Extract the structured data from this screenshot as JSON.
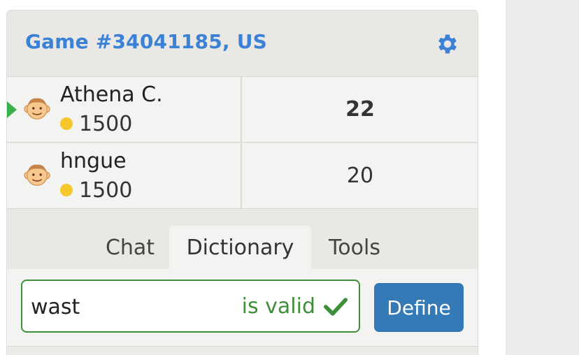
{
  "game": {
    "title": "Game #34041185, US"
  },
  "players": [
    {
      "name": "Athena C.",
      "rating": "1500",
      "score": "22",
      "active": true
    },
    {
      "name": "hngue",
      "rating": "1500",
      "score": "20",
      "active": false
    }
  ],
  "tabs": [
    {
      "label": "Chat"
    },
    {
      "label": "Dictionary",
      "selected": true
    },
    {
      "label": "Tools"
    }
  ],
  "dictionary": {
    "word": "wast",
    "status": "is valid",
    "define_label": "Define"
  },
  "icons": {
    "settings": "gear-icon",
    "avatar": "smiling-face-icon",
    "coin": "coin-icon",
    "valid": "check-icon"
  },
  "colors": {
    "accent": "#3b82d6",
    "valid": "#3f8f3a",
    "define_button": "#337ab7",
    "turn_indicator": "#3ab14a",
    "coin": "#f5c72c"
  }
}
